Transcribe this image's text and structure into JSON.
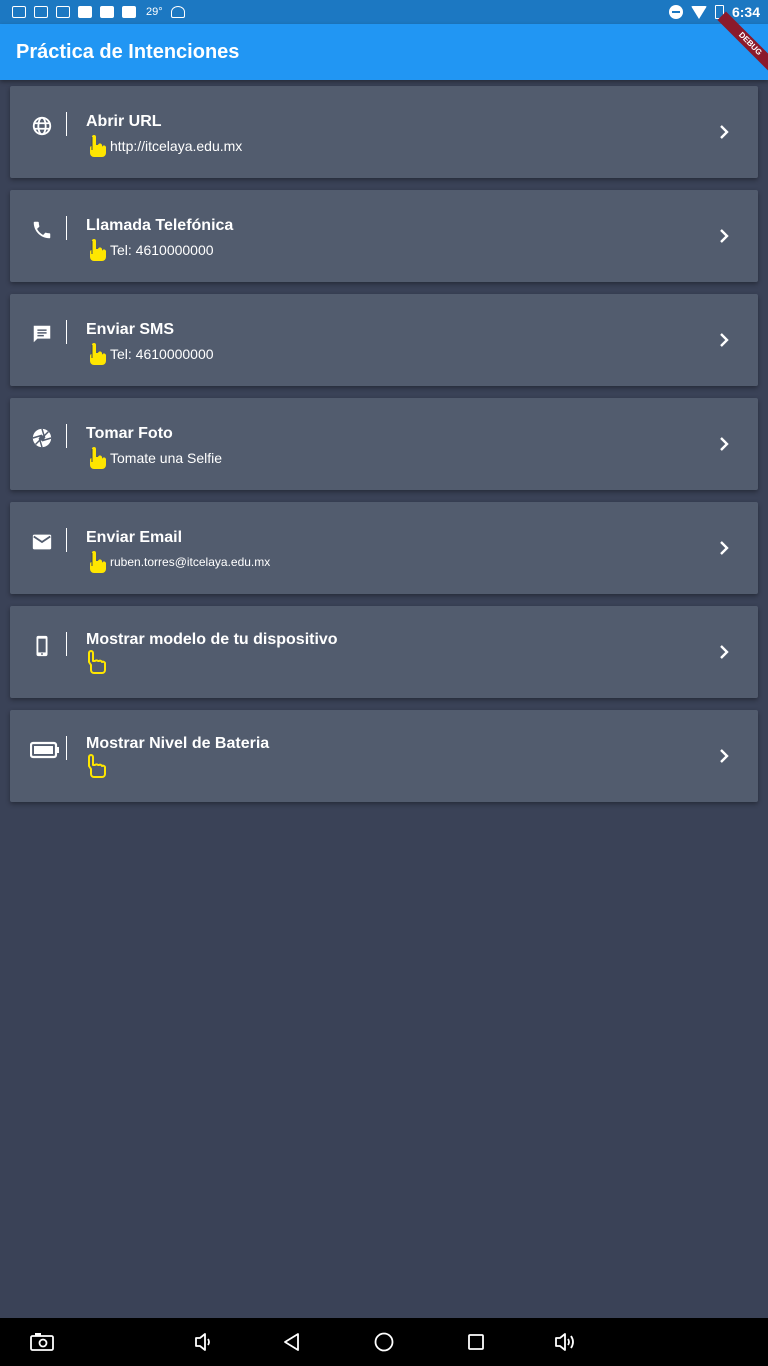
{
  "status_bar": {
    "temperature": "29°",
    "time": "6:34",
    "icons": [
      "calendar-icon",
      "gmail-icon",
      "gmail-icon",
      "sd-card-icon",
      "gb-icon",
      "gb-icon",
      "android-icon",
      "dnd-icon",
      "wifi-icon",
      "battery-icon"
    ]
  },
  "app_bar": {
    "title": "Práctica de Intenciones",
    "background": "#2196f3",
    "debug_banner": "DEBUG"
  },
  "items": [
    {
      "icon": "globe-icon",
      "title": "Abrir URL",
      "subtitle": "http://itcelaya.edu.mx",
      "action_icon": "tap-icon"
    },
    {
      "icon": "phone-icon",
      "title": "Llamada Telefónica",
      "subtitle": "Tel: 4610000000",
      "action_icon": "tap-icon"
    },
    {
      "icon": "message-icon",
      "title": "Enviar SMS",
      "subtitle": "Tel: 4610000000",
      "action_icon": "tap-icon"
    },
    {
      "icon": "camera-shutter-icon",
      "title": "Tomar Foto",
      "subtitle": "Tomate una Selfie",
      "action_icon": "tap-icon"
    },
    {
      "icon": "email-icon",
      "title": "Enviar Email",
      "subtitle": "ruben.torres@itcelaya.edu.mx",
      "action_icon": "tap-icon"
    },
    {
      "icon": "smartphone-icon",
      "title": "Mostrar modelo de tu dispositivo",
      "subtitle": "",
      "action_icon": "pointing-hand-icon"
    },
    {
      "icon": "battery-icon",
      "title": "Mostrar Nivel de Bateria",
      "subtitle": "",
      "action_icon": "pointing-hand-icon"
    }
  ],
  "colors": {
    "background": "#3a4257",
    "card": "#525c6e",
    "accent_yellow": "#ffe600"
  },
  "nav_bar": {
    "icons": [
      "screenshot-icon",
      "volume-down-icon",
      "back-icon",
      "home-icon",
      "recents-icon",
      "volume-up-icon"
    ]
  }
}
